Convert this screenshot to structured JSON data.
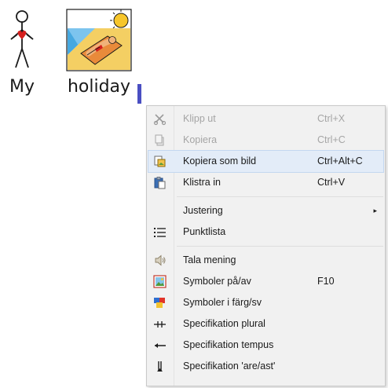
{
  "document": {
    "words": [
      {
        "text": "My",
        "symbol": "person-pointing-self-symbol"
      },
      {
        "text": "holiday",
        "symbol": "beach-sunbathing-symbol"
      }
    ],
    "caret_color": "#4a4fc2"
  },
  "context_menu": {
    "items": [
      {
        "label": "Klipp ut",
        "shortcut": "Ctrl+X",
        "icon": "scissors-icon",
        "enabled": false
      },
      {
        "label": "Kopiera",
        "shortcut": "Ctrl+C",
        "icon": "copy-icon",
        "enabled": false
      },
      {
        "label": "Kopiera som bild",
        "shortcut": "Ctrl+Alt+C",
        "icon": "copy-as-image-icon",
        "enabled": true,
        "highlighted": true
      },
      {
        "label": "Klistra in",
        "shortcut": "Ctrl+V",
        "icon": "paste-icon",
        "enabled": true
      },
      {
        "label": "Justering",
        "shortcut": "",
        "submenu_arrow": "▸",
        "enabled": true
      },
      {
        "label": "Punktlista",
        "shortcut": "",
        "icon": "bullet-list-icon",
        "enabled": true
      },
      {
        "label": "Tala mening",
        "shortcut": "",
        "icon": "speaker-icon",
        "enabled": true
      },
      {
        "label": "Symboler på/av",
        "shortcut": "F10",
        "icon": "symbols-toggle-icon",
        "enabled": true
      },
      {
        "label": "Symboler i färg/sv",
        "shortcut": "",
        "icon": "color-symbols-icon",
        "enabled": true
      },
      {
        "label": "Specifikation plural",
        "shortcut": "",
        "icon": "plural-icon",
        "enabled": true
      },
      {
        "label": "Specifikation tempus",
        "shortcut": "",
        "icon": "tense-icon",
        "enabled": true
      },
      {
        "label": "Specifikation 'are/ast'",
        "shortcut": "",
        "icon": "comparative-icon",
        "enabled": true
      }
    ],
    "colors": {
      "background": "#f1f1f1",
      "highlight": "#e3ecf8",
      "disabled_text": "#a5a5a5"
    }
  }
}
